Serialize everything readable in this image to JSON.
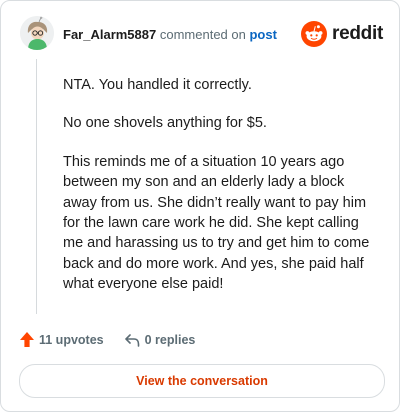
{
  "header": {
    "username": "Far_Alarm5887",
    "action_text": "commented on",
    "post_link": "post",
    "brand": "reddit"
  },
  "comment": {
    "paragraphs": [
      "NTA. You handled it correctly.",
      "No one shovels anything for $5.",
      "This reminds me of a situation 10 years ago between my son and an elderly lady a block away from us. She didn’t really want to pay him for the lawn care work he did. She kept calling me and harassing us to try and get him to come back and do more work. And yes, she paid half what everyone else paid!"
    ]
  },
  "actions": {
    "upvotes": "11 upvotes",
    "replies": "0 replies"
  },
  "view_button": "View the conversation",
  "colors": {
    "upvote": "#ff4500",
    "brand": "#ff4500",
    "link": "#0a66c2",
    "button_text": "#d93a00"
  },
  "icons": {
    "avatar": "avatar",
    "logo": "reddit-alien-icon",
    "upvote": "upvote-arrow-icon",
    "reply": "reply-arrow-icon"
  }
}
